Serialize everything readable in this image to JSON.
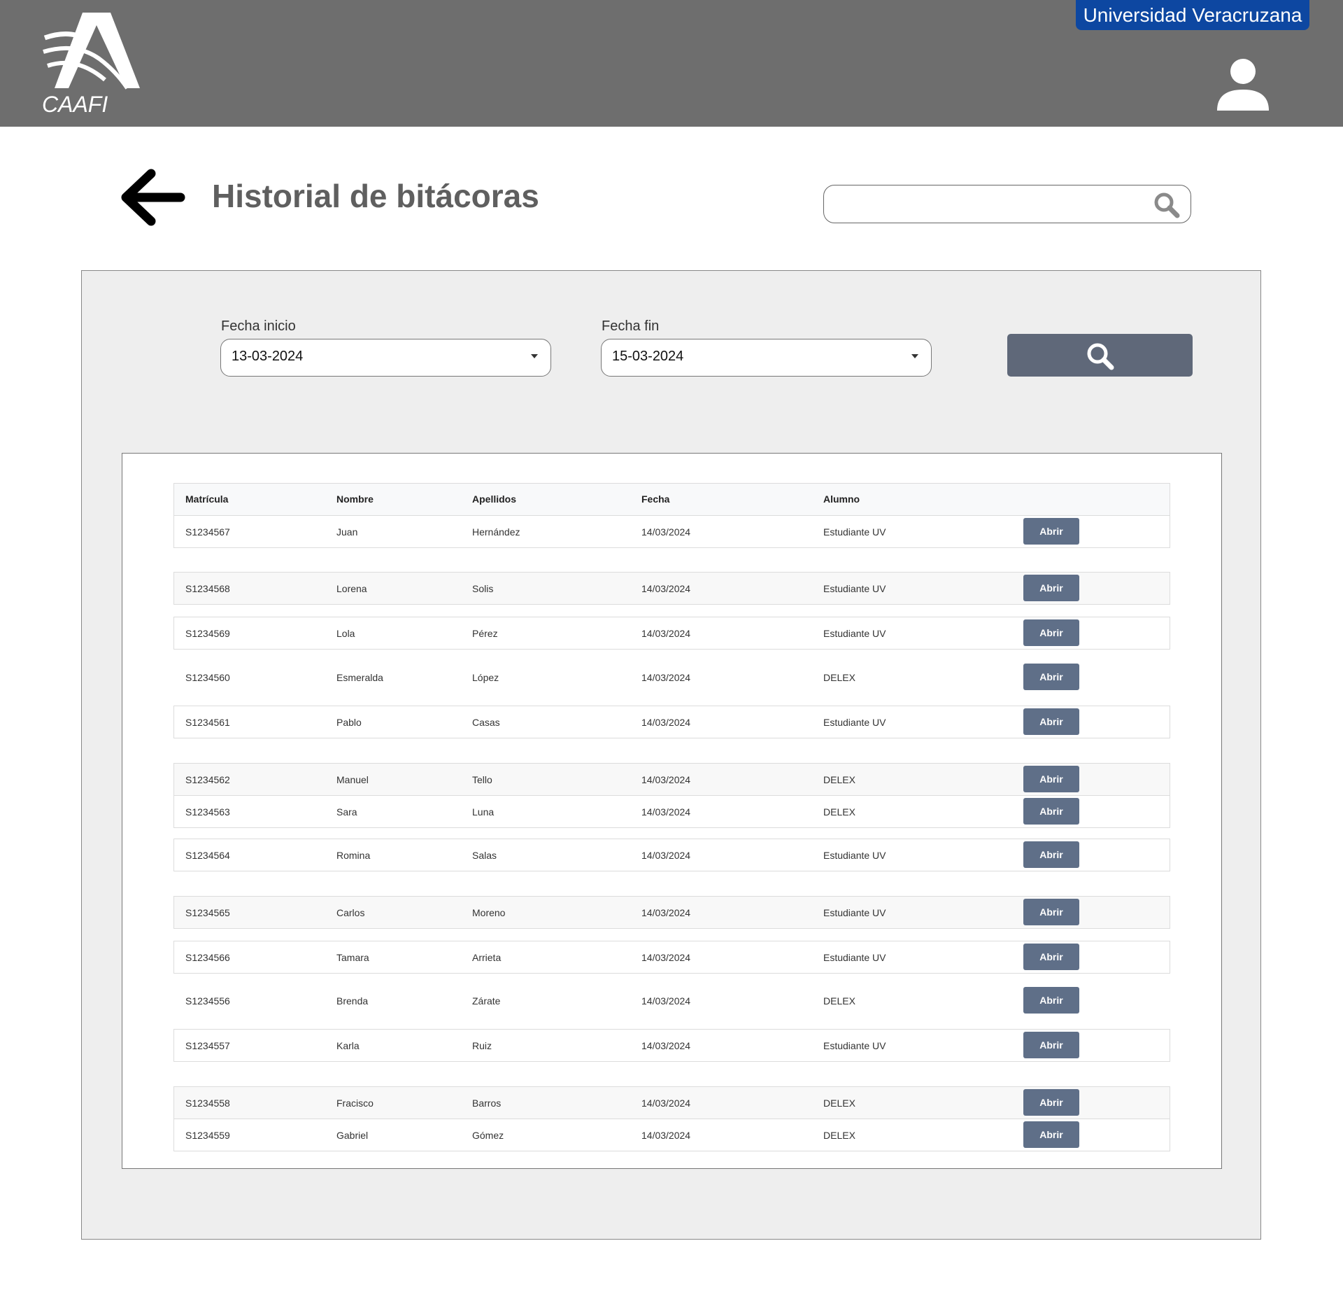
{
  "header": {
    "logo_text": "CAAFI",
    "university_badge": "Universidad Veracruzana"
  },
  "page": {
    "title": "Historial de bitácoras"
  },
  "search": {
    "value": "",
    "placeholder": ""
  },
  "filters": {
    "start_label": "Fecha inicio",
    "start_value": "13-03-2024",
    "end_label": "Fecha fin",
    "end_value": "15-03-2024"
  },
  "table": {
    "columns": [
      "Matrícula",
      "Nombre",
      "Apellidos",
      "Fecha",
      "Alumno"
    ],
    "action_label": "Abrir",
    "rows": [
      {
        "matricula": "S1234567",
        "nombre": "Juan",
        "apellidos": "Hernández",
        "fecha": "14/03/2024",
        "alumno": "Estudiante UV"
      },
      {
        "matricula": "S1234568",
        "nombre": "Lorena",
        "apellidos": "Solis",
        "fecha": "14/03/2024",
        "alumno": "Estudiante UV"
      },
      {
        "matricula": "S1234569",
        "nombre": "Lola",
        "apellidos": "Pérez",
        "fecha": "14/03/2024",
        "alumno": "Estudiante UV"
      },
      {
        "matricula": "S1234560",
        "nombre": "Esmeralda",
        "apellidos": "López",
        "fecha": "14/03/2024",
        "alumno": "DELEX"
      },
      {
        "matricula": "S1234561",
        "nombre": "Pablo",
        "apellidos": "Casas",
        "fecha": "14/03/2024",
        "alumno": "Estudiante UV"
      },
      {
        "matricula": "S1234562",
        "nombre": "Manuel",
        "apellidos": "Tello",
        "fecha": "14/03/2024",
        "alumno": "DELEX"
      },
      {
        "matricula": "S1234563",
        "nombre": "Sara",
        "apellidos": "Luna",
        "fecha": "14/03/2024",
        "alumno": "DELEX"
      },
      {
        "matricula": "S1234564",
        "nombre": "Romina",
        "apellidos": "Salas",
        "fecha": "14/03/2024",
        "alumno": "Estudiante UV"
      },
      {
        "matricula": "S1234565",
        "nombre": "Carlos",
        "apellidos": "Moreno",
        "fecha": "14/03/2024",
        "alumno": "Estudiante UV"
      },
      {
        "matricula": "S1234566",
        "nombre": "Tamara",
        "apellidos": "Arrieta",
        "fecha": "14/03/2024",
        "alumno": "Estudiante UV"
      },
      {
        "matricula": "S1234556",
        "nombre": "Brenda",
        "apellidos": "Zárate",
        "fecha": "14/03/2024",
        "alumno": "DELEX"
      },
      {
        "matricula": "S1234557",
        "nombre": "Karla",
        "apellidos": "Ruiz",
        "fecha": "14/03/2024",
        "alumno": "Estudiante UV"
      },
      {
        "matricula": "S1234558",
        "nombre": "Fracisco",
        "apellidos": "Barros",
        "fecha": "14/03/2024",
        "alumno": "DELEX"
      },
      {
        "matricula": "S1234559",
        "nombre": "Gabriel",
        "apellidos": "Gómez",
        "fecha": "14/03/2024",
        "alumno": "DELEX"
      }
    ]
  },
  "icons": {
    "logo": "caafi-logo",
    "user": "user-icon",
    "back": "arrow-left-icon",
    "search": "search-icon",
    "dropdown": "caret-down-icon"
  },
  "colors": {
    "header_bg": "#6e6e6e",
    "badge_bg": "#0d47a1",
    "button_bg": "#5f6f88",
    "search_button_bg": "#5f6879",
    "panel_bg": "#eeeeee"
  }
}
